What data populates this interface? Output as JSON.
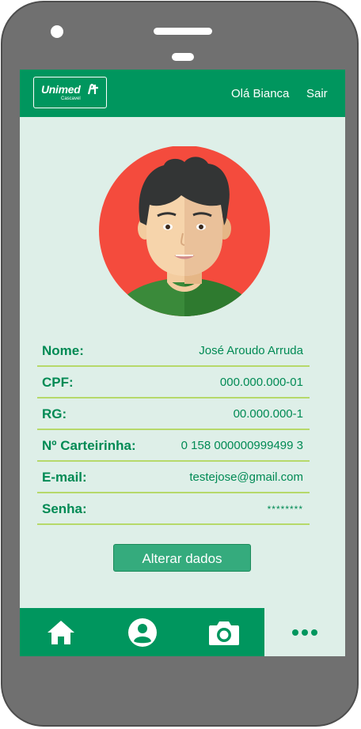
{
  "header": {
    "logo_text": "Unimed",
    "logo_subtext": "Cascavel",
    "greeting": "Olá Bianca",
    "logout_label": "Sair"
  },
  "profile": {
    "avatar_icon": "male-user-avatar",
    "fields": [
      {
        "label": "Nome:",
        "value": "José Aroudo Arruda"
      },
      {
        "label": "CPF:",
        "value": "000.000.000-01"
      },
      {
        "label": "RG:",
        "value": "00.000.000-1"
      },
      {
        "label": "Nº Carteirinha:",
        "value": "0 158 000000999499 3"
      },
      {
        "label": "E-mail:",
        "value": "testejose@gmail.com"
      },
      {
        "label": "Senha:",
        "value": "********"
      }
    ]
  },
  "actions": {
    "edit_label": "Alterar dados"
  },
  "tabbar": {
    "items": [
      {
        "icon": "home-icon"
      },
      {
        "icon": "user-circle-icon"
      },
      {
        "icon": "camera-icon"
      },
      {
        "icon": "more-dots-icon"
      }
    ],
    "active_index": 3
  },
  "colors": {
    "brand_green": "#00965e",
    "background": "#deefe8",
    "text_green": "#008a54",
    "divider": "#b6d96a",
    "button": "#35ab7d",
    "avatar_bg": "#f44b3d"
  }
}
